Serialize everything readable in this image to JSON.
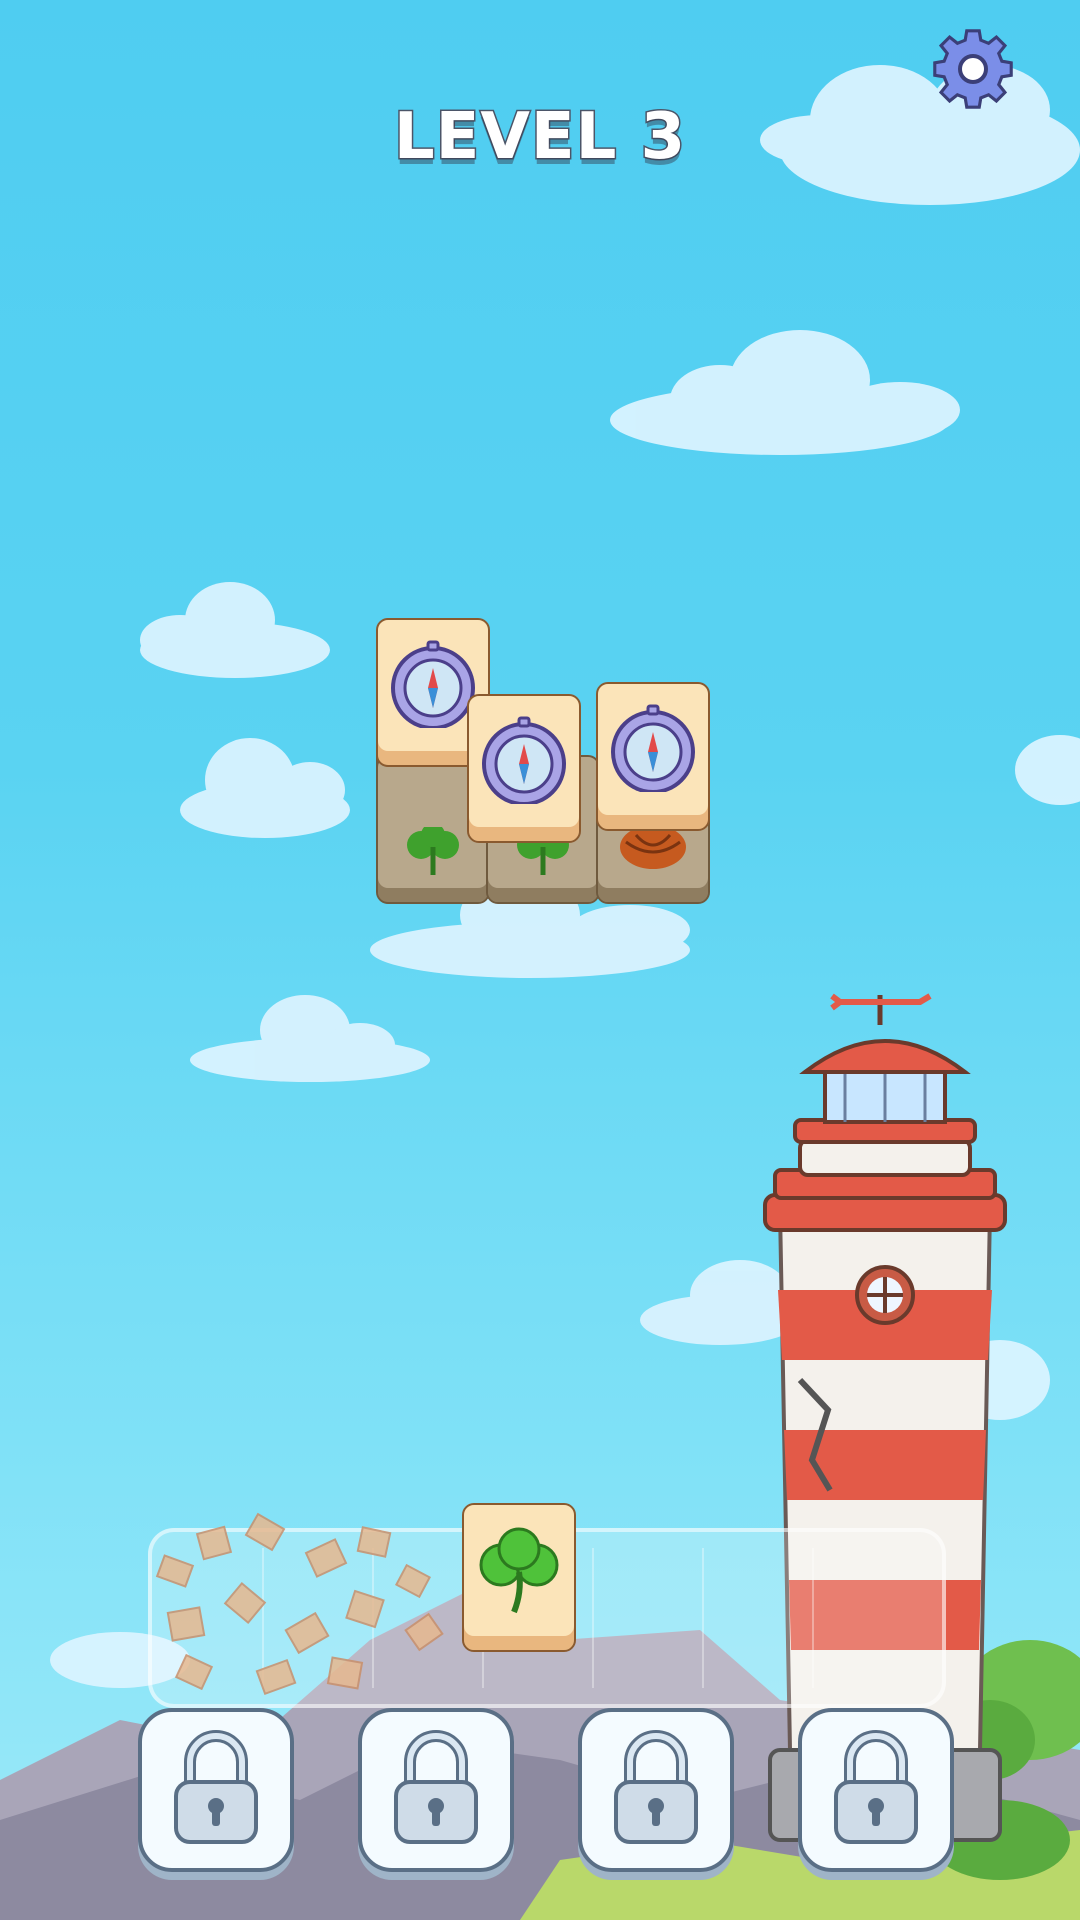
{
  "hud": {
    "level_label": "LEVEL 3",
    "settings_icon": "gear-icon"
  },
  "board": {
    "tiles": [
      {
        "id": "tile-compass-1",
        "icon": "compass-icon",
        "layer": "top",
        "selectable": true
      },
      {
        "id": "tile-compass-2",
        "icon": "compass-icon",
        "layer": "top",
        "selectable": true
      },
      {
        "id": "tile-compass-3",
        "icon": "compass-icon",
        "layer": "top",
        "selectable": true
      },
      {
        "id": "tile-pinecone-1",
        "icon": "pinecone-icon",
        "layer": "under",
        "selectable": false
      },
      {
        "id": "tile-pinecone-2",
        "icon": "pinecone-icon",
        "layer": "under",
        "selectable": false
      },
      {
        "id": "tile-clover-1",
        "icon": "clover-icon",
        "layer": "under",
        "selectable": false
      },
      {
        "id": "tile-clover-2",
        "icon": "clover-icon",
        "layer": "under",
        "selectable": false
      }
    ]
  },
  "tray": {
    "slots_total": 7,
    "filled": [
      {
        "icon": "clover-icon"
      }
    ]
  },
  "powerups": [
    {
      "icon": "padlock-icon",
      "state": "locked"
    },
    {
      "icon": "padlock-icon",
      "state": "locked"
    },
    {
      "icon": "padlock-icon",
      "state": "locked"
    },
    {
      "icon": "padlock-icon",
      "state": "locked"
    }
  ],
  "colors": {
    "sky": "#4fcdf1",
    "tile_face": "#fbe4b9",
    "tile_border": "#8a5a2f",
    "lighthouse_red": "#e35a48",
    "lock_border": "#5a6f86"
  }
}
